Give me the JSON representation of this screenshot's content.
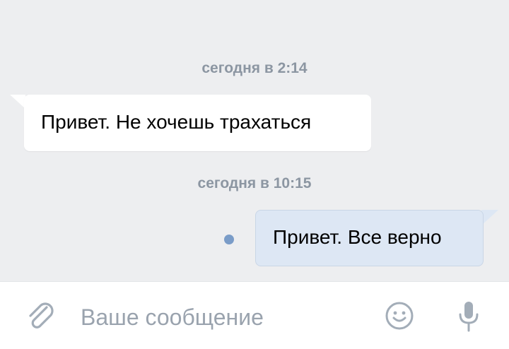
{
  "messages": [
    {
      "date_label": "сегодня в 2:14",
      "text": "Привет. Не хочешь трахаться",
      "direction": "incoming"
    },
    {
      "date_label": "сегодня в 10:15",
      "text": "Привет. Все верно",
      "direction": "outgoing",
      "unread": true
    }
  ],
  "composer": {
    "placeholder": "Ваше сообщение",
    "icons": [
      "paperclip-icon",
      "smile-icon",
      "microphone-icon"
    ]
  },
  "colors": {
    "background": "#edeef0",
    "incoming_bubble": "#ffffff",
    "outgoing_bubble": "#dde7f4",
    "date_text": "#8c96a2",
    "unread_dot": "#7a9cc8",
    "placeholder_text": "#9aa3ae"
  }
}
